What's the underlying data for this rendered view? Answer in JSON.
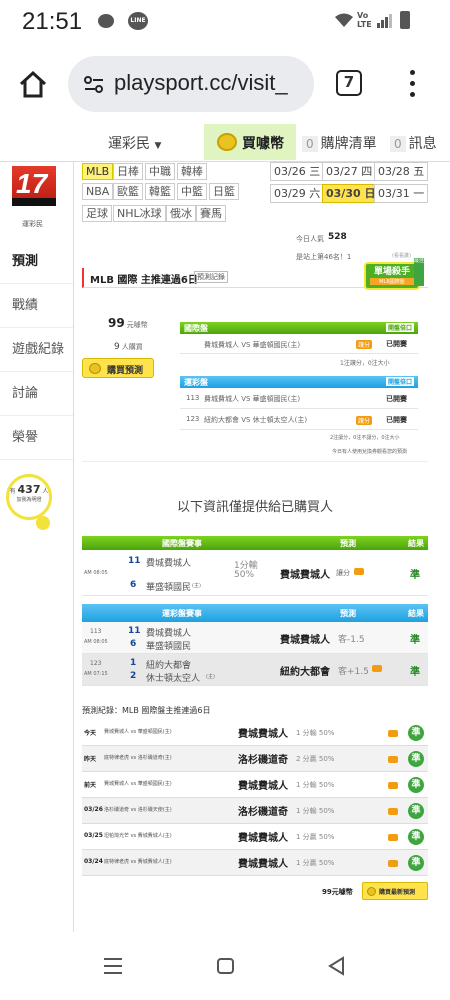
{
  "status_bar": {
    "time": "21:51",
    "network": "Vo LTE"
  },
  "browser": {
    "url": "playsport.cc/visit_",
    "tab_count": "7"
  },
  "site_nav": {
    "brand": "運彩民",
    "buy_coin": "買噱幣",
    "buy_list": {
      "count": "0",
      "label": "購牌清單"
    },
    "messages": {
      "count": "0",
      "label": "訊息"
    }
  },
  "logo": {
    "text": "17",
    "caption": "運彩民"
  },
  "left_nav": [
    "預測",
    "戰績",
    "遊戲紀錄",
    "討論",
    "榮譽"
  ],
  "left_nav_promo": {
    "prefix": "有",
    "count": "437",
    "unit": "人",
    "suffix": "加我為明燈"
  },
  "filters": {
    "row1": [
      "MLB",
      "日棒",
      "中職",
      "韓棒"
    ],
    "row2": [
      "NBA",
      "歐籃",
      "韓籃",
      "中籃",
      "日籃"
    ],
    "row3": [
      "足球",
      "NHL冰球",
      "俄冰",
      "賽馬"
    ]
  },
  "dates": {
    "row1": [
      "03/26 三",
      "03/27 四",
      "03/28 五"
    ],
    "row2": [
      "03/29 六",
      "03/30 日",
      "03/31 一"
    ]
  },
  "visitors": {
    "label": "今日人氣",
    "value": "528",
    "rank": "是站上第46名！1",
    "rank_link": "(看看誰)"
  },
  "promo_badge": {
    "title": "單場殺手",
    "sub": "MLB國際盤",
    "ribbon": "最佳"
  },
  "streak": {
    "title": "MLB 國際 主推連過6日",
    "link": "預測記錄"
  },
  "price": {
    "amount": "99",
    "unit": "元噱幣",
    "buyers": "9",
    "buyers_unit": "人購買"
  },
  "buy_button": "購買預測",
  "intl_block": {
    "header": "國際盤",
    "header_right": "開盤倍口",
    "rows": [
      {
        "game": "費城費城人 VS 華盛頓國民(主)",
        "badge": "讓分",
        "status": "已開賽"
      }
    ],
    "footer": "1注讓分，0注大小"
  },
  "lottery_block": {
    "header": "運彩盤",
    "header_right": "開盤倍口",
    "rows": [
      {
        "num": "113",
        "game": "費城費城人 VS 華盛頓國民(主)",
        "badge": "",
        "status": "已開賽"
      },
      {
        "num": "123",
        "game": "紐約大都會 VS 休士頓太空人(主)",
        "badge": "讓分",
        "status": "已開賽"
      }
    ],
    "footer": "2注讓分，0注不讓分，0注大小",
    "note": "今日有人使用兌換券觀看您的預測"
  },
  "purchased_title": "以下資訊僅提供給已購買人",
  "intl_table": {
    "headers": [
      "國際盤賽事",
      "預測",
      "結果"
    ],
    "row": {
      "time": "AM 08:05",
      "num1": "11",
      "team1": "費城費城人",
      "num2": "6",
      "team2": "華盛頓國民",
      "home": "(主)",
      "line": "1分輸",
      "pct": "50%",
      "pick": "費城費城人",
      "pick_type": "讓分",
      "result": "準"
    }
  },
  "lottery_table": {
    "headers": [
      "運彩盤賽事",
      "預測",
      "結果"
    ],
    "rows": [
      {
        "num": "113",
        "time": "AM 08:05",
        "n1": "11",
        "t1": "費城費城人",
        "n2": "6",
        "t2": "華盛頓國民",
        "home": "(主)",
        "pick": "費城費城人",
        "pick_line": "客-1.5",
        "result": "準"
      },
      {
        "num": "123",
        "time": "AM 07:15",
        "n1": "1",
        "t1": "紐約大都會",
        "n2": "2",
        "t2": "休士頓太空人",
        "home": "(主)",
        "pick": "紐約大都會",
        "pick_line": "客+1.5",
        "result": "準"
      }
    ]
  },
  "history": {
    "title": "預測紀錄：MLB 國際盤主推連過6日",
    "rows": [
      {
        "day": "今天",
        "game": "費城費城人 vs 華盛頓國民(主)",
        "pick": "費城費城人",
        "line": "1 分輸 50%",
        "result": "準"
      },
      {
        "day": "昨天",
        "game": "底特律老虎 vs 洛杉磯道奇(主)",
        "pick": "洛杉磯道奇",
        "line": "2 分贏 50%",
        "result": "準"
      },
      {
        "day": "前天",
        "game": "費城費城人 vs 華盛頓國民(主)",
        "pick": "費城費城人",
        "line": "1 分輸 50%",
        "result": "準"
      },
      {
        "day": "03/26",
        "game": "洛杉磯道奇 vs 洛杉磯天使(主)",
        "pick": "洛杉磯道奇",
        "line": "1 分輸 50%",
        "result": "準"
      },
      {
        "day": "03/25",
        "game": "坦帕灣光芒 vs 費城費城人(主)",
        "pick": "費城費城人",
        "line": "1 分贏 50%",
        "result": "準"
      },
      {
        "day": "03/24",
        "game": "底特律老虎 vs 費城費城人(主)",
        "pick": "費城費城人",
        "line": "1 分贏 50%",
        "result": "準"
      }
    ],
    "price": "99元噱幣",
    "buy_latest": "購買最新預測"
  }
}
